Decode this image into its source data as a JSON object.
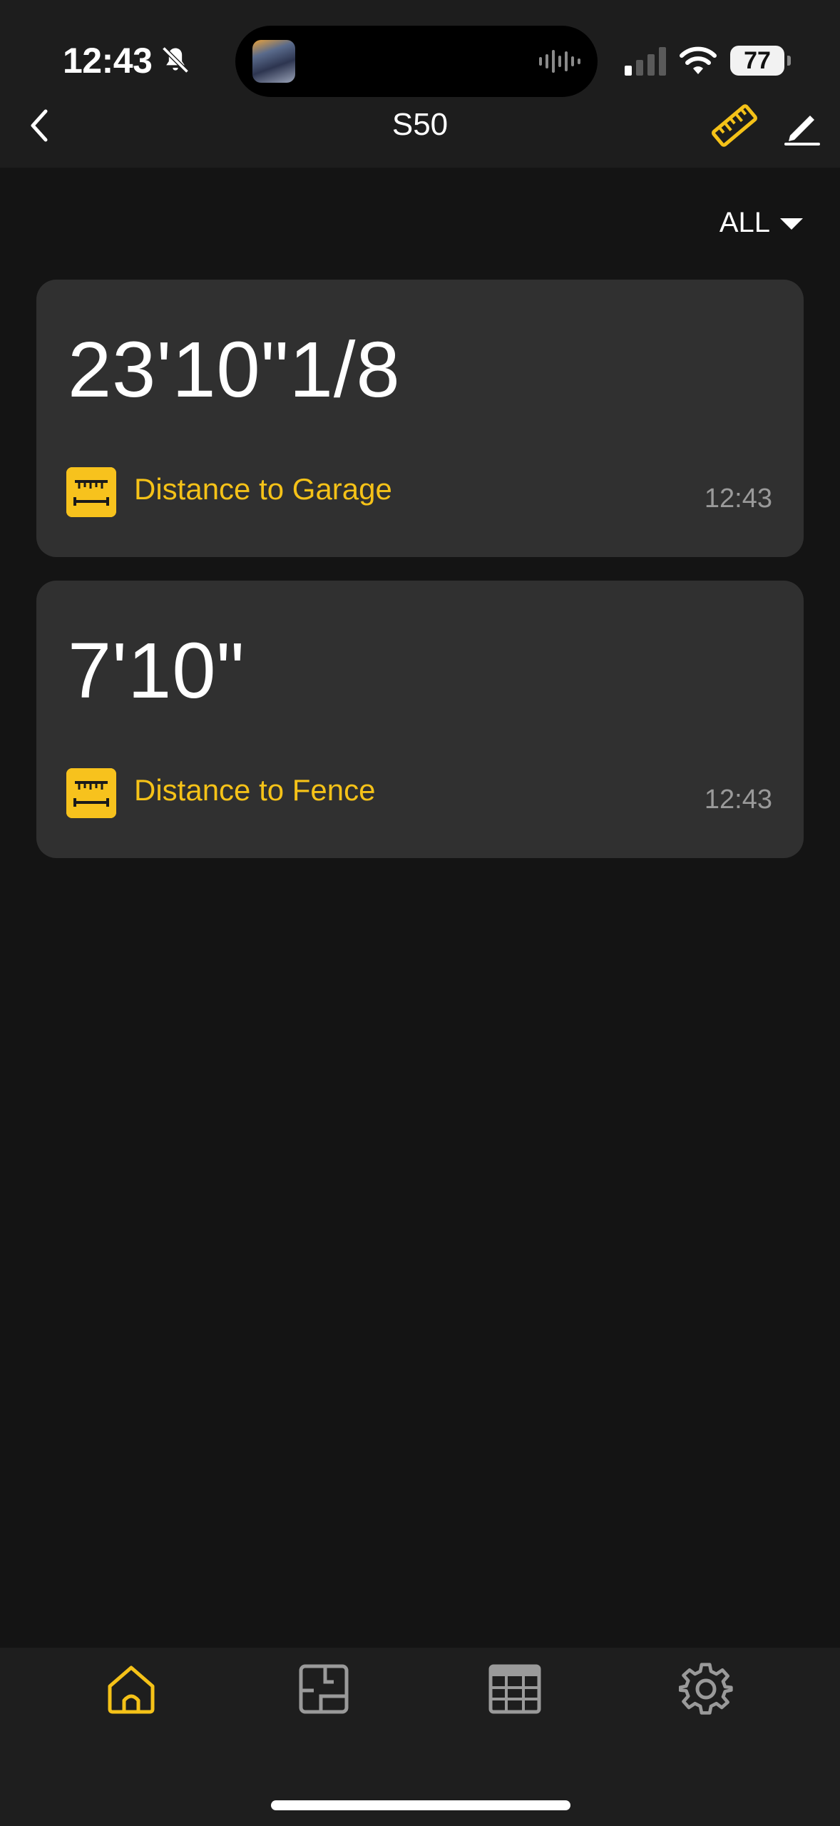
{
  "status_bar": {
    "time": "12:43",
    "battery": "77",
    "icons": [
      "bell-slash-icon",
      "signal-icon",
      "wifi-icon",
      "battery-icon"
    ]
  },
  "nav": {
    "title": "S50",
    "back_icon": "chevron-left-icon",
    "ruler_icon": "ruler-icon",
    "edit_icon": "pencil-icon"
  },
  "filter": {
    "label": "ALL"
  },
  "measurements": [
    {
      "value": "23'10\"1/8",
      "label": "Distance to Garage",
      "time": "12:43"
    },
    {
      "value": "7'10\"",
      "label": "Distance to Fence",
      "time": "12:43"
    }
  ],
  "tabs": [
    {
      "name": "home",
      "icon": "home-icon",
      "active": true
    },
    {
      "name": "floorplan",
      "icon": "floorplan-icon",
      "active": false
    },
    {
      "name": "table",
      "icon": "table-icon",
      "active": false
    },
    {
      "name": "settings",
      "icon": "gear-icon",
      "active": false
    }
  ],
  "colors": {
    "accent": "#f5c218",
    "background": "#141414",
    "card": "#303030",
    "bar": "#1d1d1d"
  }
}
